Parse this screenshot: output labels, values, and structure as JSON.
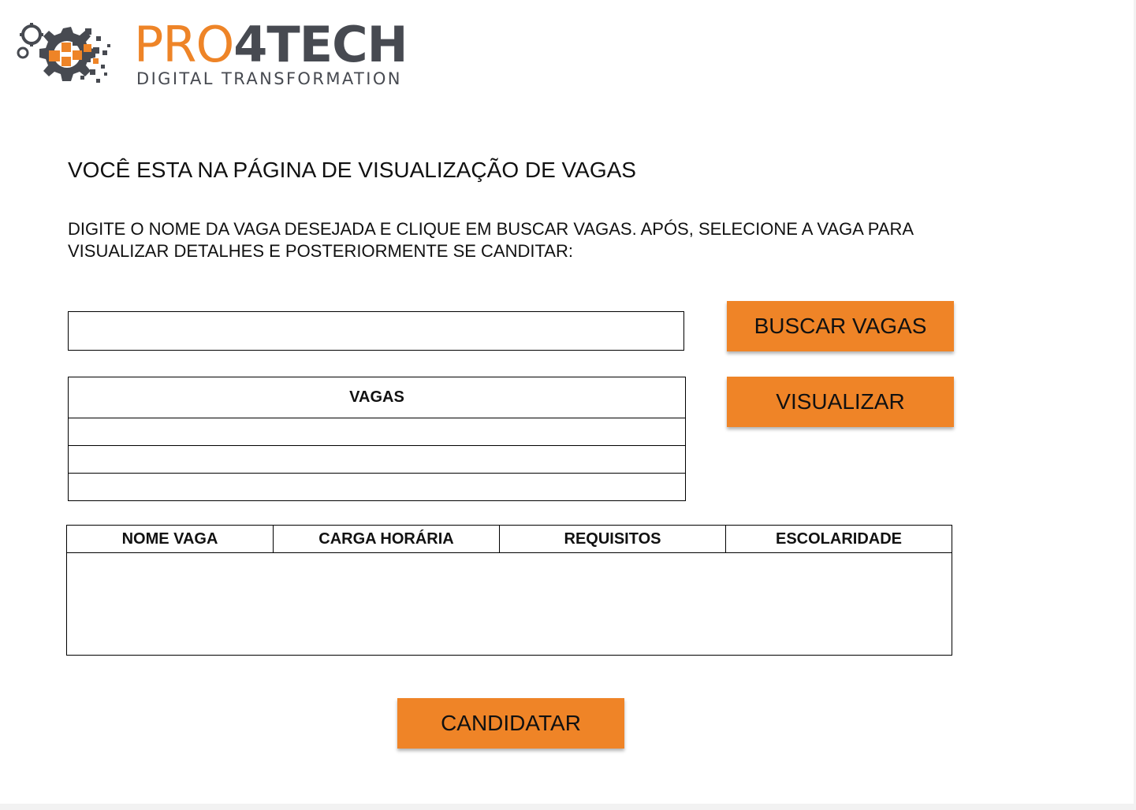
{
  "brand": {
    "name_part1": "PRO",
    "name_part2": "4TECH",
    "tagline": "DIGITAL TRANSFORMATION",
    "colors": {
      "orange": "#ee8427",
      "gray": "#474a51"
    }
  },
  "page": {
    "title": "VOCÊ ESTA NA PÁGINA DE VISUALIZAÇÃO DE VAGAS",
    "instructions": "DIGITE O NOME DA VAGA DESEJADA E CLIQUE EM BUSCAR VAGAS. APÓS, SELECIONE A VAGA PARA VISUALIZAR DETALHES E POSTERIORMENTE SE CANDITAR:"
  },
  "search": {
    "value": "",
    "placeholder": ""
  },
  "buttons": {
    "buscar": "BUSCAR VAGAS",
    "visualizar": "VISUALIZAR",
    "candidatar": "CANDIDATAR",
    "color": "#ef8427"
  },
  "vagas_table": {
    "header": "VAGAS",
    "rows": [
      "",
      "",
      ""
    ]
  },
  "details_table": {
    "columns": [
      "NOME VAGA",
      "CARGA HORÁRIA",
      "REQUISITOS",
      "ESCOLARIDADE"
    ]
  }
}
